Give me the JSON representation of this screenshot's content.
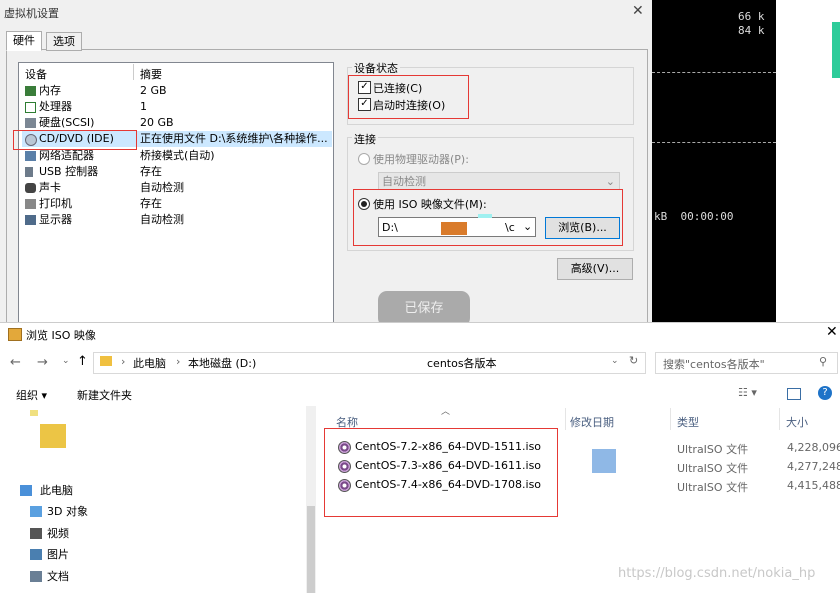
{
  "vm_dialog": {
    "title": "虚拟机设置",
    "tabs": [
      "硬件",
      "选项"
    ],
    "devices_header": {
      "device": "设备",
      "summary": "摘要"
    },
    "devices": [
      {
        "name": "内存",
        "summary": "2 GB",
        "icon": "memory-icon"
      },
      {
        "name": "处理器",
        "summary": "1",
        "icon": "cpu-icon"
      },
      {
        "name": "硬盘(SCSI)",
        "summary": "20 GB",
        "icon": "disk-icon"
      },
      {
        "name": "CD/DVD (IDE)",
        "summary": "正在使用文件 D:\\系统维护\\各种操作...",
        "icon": "cd-icon",
        "selected": true
      },
      {
        "name": "网络适配器",
        "summary": "桥接模式(自动)",
        "icon": "network-icon"
      },
      {
        "name": "USB 控制器",
        "summary": "存在",
        "icon": "usb-icon"
      },
      {
        "name": "声卡",
        "summary": "自动检测",
        "icon": "sound-icon"
      },
      {
        "name": "打印机",
        "summary": "存在",
        "icon": "printer-icon"
      },
      {
        "name": "显示器",
        "summary": "自动检测",
        "icon": "display-icon"
      }
    ],
    "device_status": {
      "title": "设备状态",
      "connected": "已连接(C)",
      "connect_on_power": "启动时连接(O)"
    },
    "connection": {
      "title": "连接",
      "physical": "使用物理驱动器(P):",
      "auto_detect": "自动检测",
      "iso": "使用 ISO 映像文件(M):",
      "iso_path_start": "D:\\",
      "iso_path_end": "\\c",
      "browse": "浏览(B)..."
    },
    "advanced": "高级(V)...",
    "saved": "已保存"
  },
  "terminal": {
    "lines": [
      "66 k",
      "84 k",
      "kB  00:00:00"
    ]
  },
  "file_browser": {
    "title": "浏览 ISO 映像",
    "breadcrumb": [
      "此电脑",
      "本地磁盘 (D:)",
      "centos各版本"
    ],
    "search_placeholder": "搜索\"centos各版本\"",
    "toolbar": {
      "organize": "组织 ▾",
      "new_folder": "新建文件夹"
    },
    "columns": {
      "name": "名称",
      "modified": "修改日期",
      "type": "类型",
      "size": "大小"
    },
    "files": [
      {
        "name": "CentOS-7.2-x86_64-DVD-1511.iso",
        "type": "UltraISO 文件",
        "size": "4,228,096."
      },
      {
        "name": "CentOS-7.3-x86_64-DVD-1611.iso",
        "type": "UltraISO 文件",
        "size": "4,277,248."
      },
      {
        "name": "CentOS-7.4-x86_64-DVD-1708.iso",
        "type": "UltraISO 文件",
        "size": "4,415,488."
      }
    ],
    "nav": [
      {
        "label": "此电脑",
        "icon": "computer-icon"
      },
      {
        "label": "3D 对象",
        "icon": "cube-icon"
      },
      {
        "label": "视频",
        "icon": "video-icon"
      },
      {
        "label": "图片",
        "icon": "picture-icon"
      },
      {
        "label": "文档",
        "icon": "document-icon"
      }
    ]
  },
  "watermark": "https://blog.csdn.net/nokia_hp",
  "colors": {
    "accent_red": "#e53935",
    "selection": "#cce8ff",
    "terminal_bg": "#000000"
  }
}
